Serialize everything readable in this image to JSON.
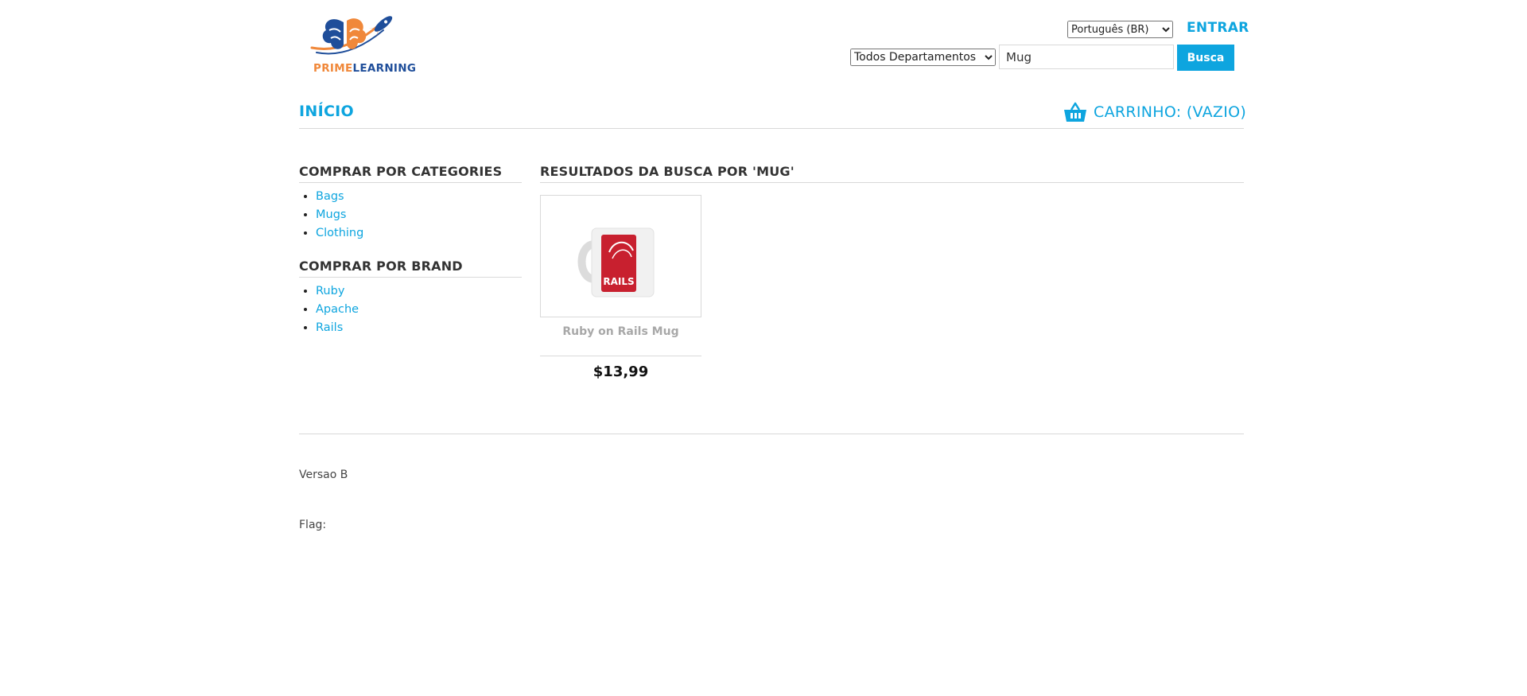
{
  "header": {
    "logo": {
      "prime": "PRIME",
      "learning": "LEARNING"
    },
    "language": {
      "selected": "Português (BR)",
      "options": [
        "Português (BR)"
      ]
    },
    "login_label": "ENTRAR",
    "department": {
      "selected": "Todos Departamentos",
      "options": [
        "Todos Departamentos"
      ]
    },
    "search": {
      "value": "Mug",
      "button_label": "Busca"
    }
  },
  "nav": {
    "home_label": "INÍCIO",
    "cart_label": "CARRINHO: (VAZIO)",
    "cart_icon": "shopping-basket-icon"
  },
  "sidebar": {
    "categories": {
      "heading": "COMPRAR POR CATEGORIES",
      "items": [
        "Bags",
        "Mugs",
        "Clothing"
      ]
    },
    "brands": {
      "heading": "COMPRAR POR BRAND",
      "items": [
        "Ruby",
        "Apache",
        "Rails"
      ]
    }
  },
  "results": {
    "heading": "RESULTADOS DA BUSCA POR 'MUG'",
    "products": [
      {
        "name": "Ruby on Rails Mug",
        "price": "$13,99",
        "image_label": "RAILS"
      }
    ]
  },
  "footer": {
    "version": "Versao B",
    "flag": "Flag:"
  },
  "colors": {
    "accent": "#0ea5df",
    "logo_orange": "#f0883a",
    "logo_blue": "#1f4e9a",
    "divider": "#d9d9d9",
    "mug_red": "#c8202f"
  }
}
